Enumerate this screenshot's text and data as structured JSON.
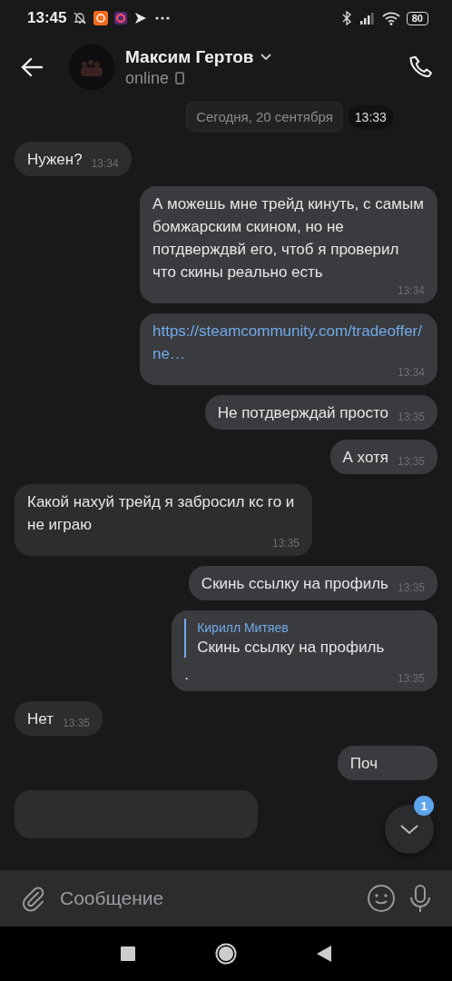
{
  "status_bar": {
    "time": "13:45",
    "battery": "80"
  },
  "header": {
    "name": "Максим Гертов",
    "status": "online"
  },
  "date_chip": "Сегодня, 20 сентября",
  "prev_time": "13:33",
  "messages": [
    {
      "kind": "text",
      "outgoing": false,
      "text": "Нужен?",
      "time": "13:34"
    },
    {
      "kind": "text",
      "outgoing": true,
      "text": "А можешь мне трейд кинуть, с самым бомжарским скином, но не потдверждвй его, чтоб я проверил что скины реально есть",
      "time": "13:34"
    },
    {
      "kind": "link",
      "outgoing": true,
      "text": "https://steamcommunity.com/tradeoffer/ne…",
      "time": "13:34"
    },
    {
      "kind": "text",
      "outgoing": true,
      "text": "Не потдверждай просто",
      "time": "13:35"
    },
    {
      "kind": "text",
      "outgoing": true,
      "text": "А хотя",
      "time": "13:35"
    },
    {
      "kind": "text",
      "outgoing": false,
      "text": "Какой нахуй трейд я забросил кс го и не играю",
      "time": "13:35"
    },
    {
      "kind": "text",
      "outgoing": true,
      "text": "Скинь ссылку на профиль",
      "time": "13:35"
    },
    {
      "kind": "reply",
      "outgoing": true,
      "reply_author": "Кирилл Митяев",
      "reply_text": "Скинь ссылку на профиль",
      "text": ".",
      "time": "13:35"
    },
    {
      "kind": "text",
      "outgoing": false,
      "text": "Нет",
      "time": "13:35"
    },
    {
      "kind": "text",
      "outgoing": true,
      "text": "Поч"
    }
  ],
  "scroll_badge": "1",
  "composer": {
    "placeholder": "Сообщение"
  }
}
